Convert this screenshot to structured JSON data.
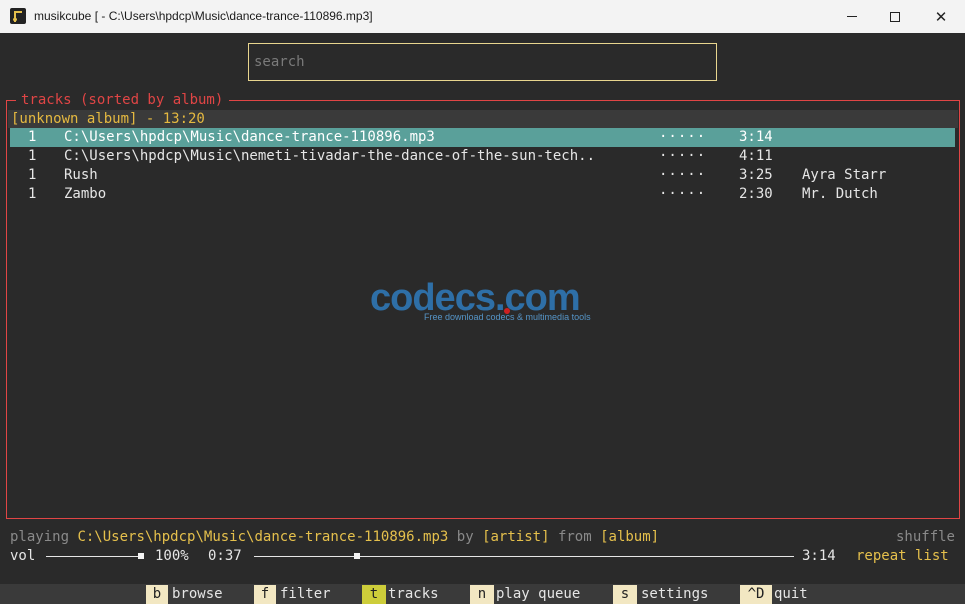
{
  "window": {
    "title": "musikcube [ - C:\\Users\\hpdcp\\Music\\dance-trance-110896.mp3]",
    "min_glyph": "minimize-icon",
    "max_glyph": "maximize-icon",
    "close_glyph": "✕"
  },
  "search": {
    "placeholder": "search",
    "value": ""
  },
  "tracks": {
    "title": "tracks (sorted by album)",
    "album_header": "[unknown album] - 13:20",
    "rows": [
      {
        "num": "1",
        "title": "C:\\Users\\hpdcp\\Music\\dance-trance-110896.mp3",
        "rating": "·····",
        "duration": "3:14",
        "artist": "",
        "selected": true
      },
      {
        "num": "1",
        "title": "C:\\Users\\hpdcp\\Music\\nemeti-tivadar-the-dance-of-the-sun-tech..",
        "rating": "·····",
        "duration": "4:11",
        "artist": "",
        "selected": false
      },
      {
        "num": "1",
        "title": "Rush",
        "rating": "·····",
        "duration": "3:25",
        "artist": "Ayra Starr",
        "selected": false
      },
      {
        "num": "1",
        "title": "Zambo",
        "rating": "·····",
        "duration": "2:30",
        "artist": "Mr. Dutch",
        "selected": false
      }
    ]
  },
  "watermark": {
    "text": "codecs.com",
    "subtitle": "Free download codecs & multimedia tools"
  },
  "status": {
    "playing_label": "playing",
    "track": "C:\\Users\\hpdcp\\Music\\dance-trance-110896.mp3",
    "by_label": "by",
    "artist": "[artist]",
    "from_label": "from",
    "album": "[album]",
    "shuffle": "shuffle"
  },
  "playback": {
    "vol_label": "vol",
    "volume": "100%",
    "volume_level": 1.0,
    "elapsed": "0:37",
    "total": "3:14",
    "progress_fraction": 0.19,
    "repeat": "repeat list"
  },
  "footer": {
    "items": [
      {
        "key": "b",
        "label": "browse",
        "active": false
      },
      {
        "key": "f",
        "label": "filter",
        "active": false
      },
      {
        "key": "t",
        "label": "tracks",
        "active": true
      },
      {
        "key": "n",
        "label": "play queue",
        "active": false
      },
      {
        "key": "s",
        "label": "settings",
        "active": false
      },
      {
        "key": "^D",
        "label": "quit",
        "active": false
      }
    ]
  },
  "colors": {
    "accent_red": "#e04545",
    "accent_yellow": "#e5c04c",
    "selection": "#5aa09a",
    "search_border": "#e8d58e",
    "key_bg": "#f2e7c2",
    "key_active_bg": "#cdcd3a"
  }
}
